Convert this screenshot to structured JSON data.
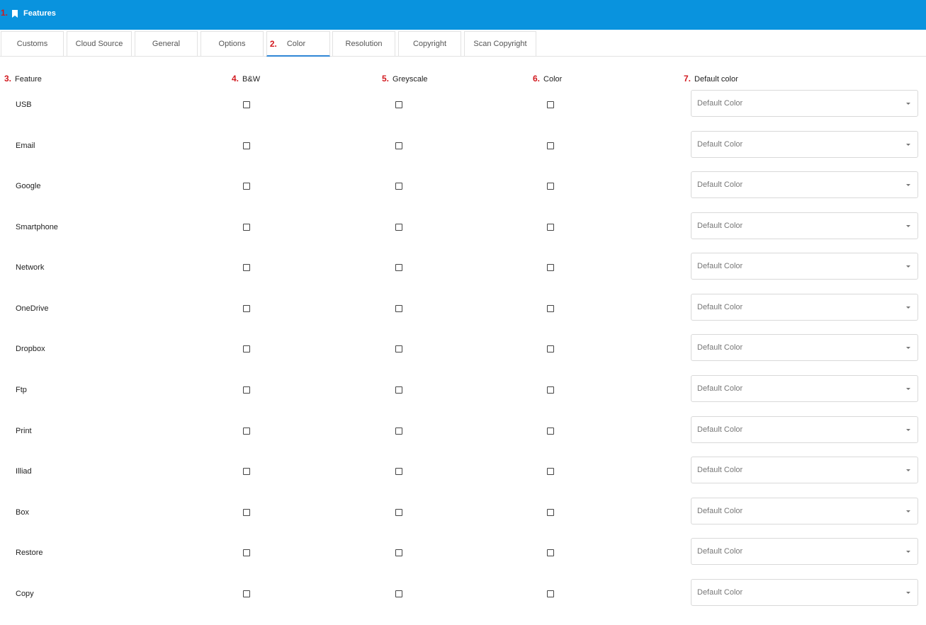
{
  "header": {
    "marker": "1.",
    "title": "Features",
    "icon": "bookmark-icon"
  },
  "tabs": [
    {
      "label": "Customs"
    },
    {
      "label": "Cloud Source"
    },
    {
      "label": "General"
    },
    {
      "label": "Options"
    },
    {
      "label": "Color",
      "marker": "2.",
      "active": true
    },
    {
      "label": "Resolution"
    },
    {
      "label": "Copyright"
    },
    {
      "label": "Scan Copyright"
    }
  ],
  "columns": {
    "feature": {
      "marker": "3.",
      "label": "Feature"
    },
    "bw": {
      "marker": "4.",
      "label": "B&W"
    },
    "greyscale": {
      "marker": "5.",
      "label": "Greyscale"
    },
    "color": {
      "marker": "6.",
      "label": "Color"
    },
    "default_color": {
      "marker": "7.",
      "label": "Default color"
    }
  },
  "rows": [
    {
      "feature": "USB",
      "default_color": "Default Color"
    },
    {
      "feature": "Email",
      "default_color": "Default Color"
    },
    {
      "feature": "Google",
      "default_color": "Default Color"
    },
    {
      "feature": "Smartphone",
      "default_color": "Default Color"
    },
    {
      "feature": "Network",
      "default_color": "Default Color"
    },
    {
      "feature": "OneDrive",
      "default_color": "Default Color"
    },
    {
      "feature": "Dropbox",
      "default_color": "Default Color"
    },
    {
      "feature": "Ftp",
      "default_color": "Default Color"
    },
    {
      "feature": "Print",
      "default_color": "Default Color"
    },
    {
      "feature": "Illiad",
      "default_color": "Default Color"
    },
    {
      "feature": "Box",
      "default_color": "Default Color"
    },
    {
      "feature": "Restore",
      "default_color": "Default Color"
    },
    {
      "feature": "Copy",
      "default_color": "Default Color"
    }
  ],
  "colors": {
    "header_bg": "#0993de",
    "marker": "#d2191f",
    "active_tab": "#2f86d6"
  }
}
